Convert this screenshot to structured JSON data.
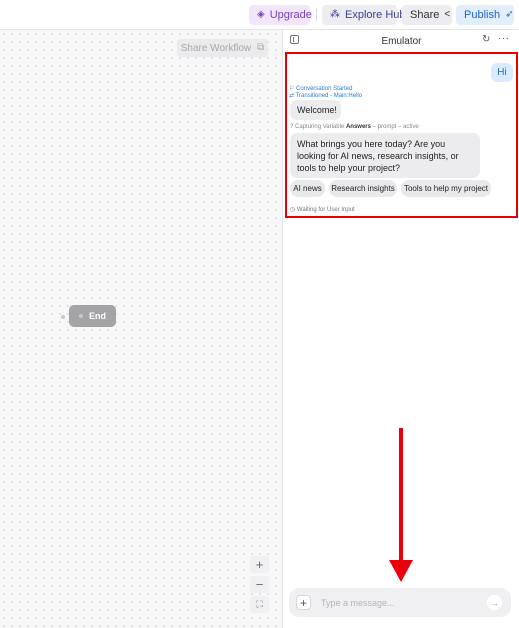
{
  "topbar": {
    "upgrade": {
      "icon": "gem-icon",
      "label": "Upgrade"
    },
    "explore": {
      "icon": "explore-hub-icon",
      "label": "Explore Hub"
    },
    "share": {
      "label": "Share",
      "icon": "share-icon"
    },
    "publish": {
      "label": "Publish",
      "icon": "rocket-icon"
    }
  },
  "canvas": {
    "share_workflow": "Share Workflow",
    "end_node": "End",
    "zoom_in": "+",
    "zoom_out": "−"
  },
  "emulator": {
    "title": "Emulator",
    "user_message": "Hi",
    "event_started": "Conversation Started",
    "event_transitioned": "Transitioned - Main:Hello",
    "bot_welcome": "Welcome!",
    "capture_prefix": "Capturing Variable",
    "capture_var": "Answers",
    "capture_suffix": "– prompt – active",
    "bot_question": "What brings you here today? Are you looking for AI news, research insights, or tools to help your project?",
    "choices": [
      "AI news",
      "Research insights",
      "Tools to help my project"
    ],
    "waiting": "Waiting for User Input",
    "input_placeholder": "Type a message..."
  },
  "colors": {
    "accent_blue": "#1f63c9",
    "highlight_red": "#e60000",
    "upgrade_purple": "#7a3fc2"
  }
}
